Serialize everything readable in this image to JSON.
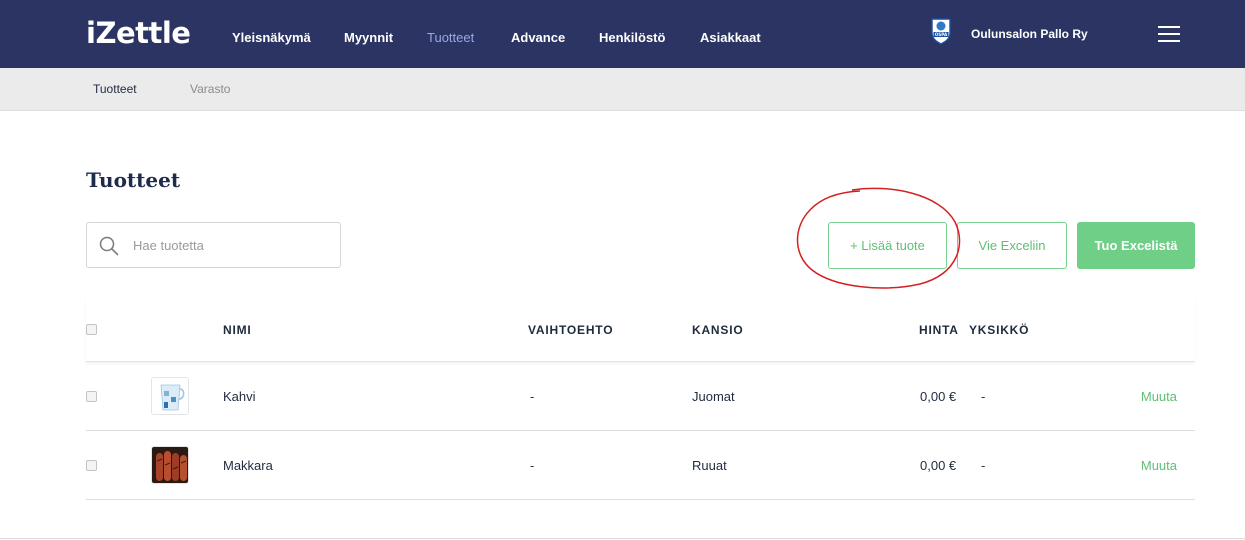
{
  "app": {
    "logo": "iZettle"
  },
  "nav": {
    "items": [
      {
        "label": "Yleisnäkymä",
        "active": false
      },
      {
        "label": "Myynnit",
        "active": false
      },
      {
        "label": "Tuotteet",
        "active": true
      },
      {
        "label": "Advance",
        "active": false
      },
      {
        "label": "Henkilöstö",
        "active": false
      },
      {
        "label": "Asiakkaat",
        "active": false
      }
    ],
    "organization": "Oulunsalon Pallo Ry",
    "badge_text": "OSPA",
    "menu_icon": "hamburger-icon"
  },
  "subnav": {
    "items": [
      {
        "label": "Tuotteet",
        "active": true
      },
      {
        "label": "Varasto",
        "active": false
      }
    ]
  },
  "page": {
    "title": "Tuotteet"
  },
  "search": {
    "placeholder": "Hae tuotetta",
    "value": "",
    "icon": "search-icon"
  },
  "actions": {
    "add_product": "+ Lisää tuote",
    "export_excel": "Vie Exceliin",
    "import_excel": "Tuo Excelistä"
  },
  "table": {
    "columns": [
      "NIMI",
      "VAIHTOEHTO",
      "KANSIO",
      "HINTA",
      "YKSIKKÖ"
    ],
    "rows": [
      {
        "name": "Kahvi",
        "variant": "-",
        "folder": "Juomat",
        "price": "0,00 €",
        "unit": "-",
        "action": "Muuta",
        "thumb": "coffee-cup-icon"
      },
      {
        "name": "Makkara",
        "variant": "-",
        "folder": "Ruuat",
        "price": "0,00 €",
        "unit": "-",
        "action": "Muuta",
        "thumb": "sausage-image"
      }
    ]
  },
  "colors": {
    "topbar": "#2b3462",
    "active_nav": "#9aa8e6",
    "accent_green": "#6fcf86",
    "annotation_red": "#d42020"
  }
}
